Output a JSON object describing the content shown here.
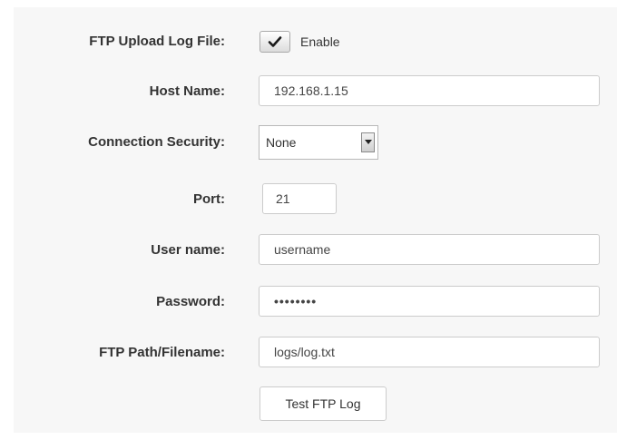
{
  "form": {
    "ftp_upload": {
      "label": "FTP Upload Log File:",
      "checked": true,
      "checkbox_label": "Enable"
    },
    "host_name": {
      "label": "Host Name:",
      "value": "192.168.1.15"
    },
    "connection_security": {
      "label": "Connection Security:",
      "selected": "None"
    },
    "port": {
      "label": "Port:",
      "value": "21"
    },
    "user_name": {
      "label": "User name:",
      "value": "username"
    },
    "password": {
      "label": "Password:",
      "masked_value": "••••••••"
    },
    "ftp_path": {
      "label": "FTP Path/Filename:",
      "value": "logs/log.txt"
    },
    "test_button": {
      "label": "Test FTP Log"
    }
  },
  "icons": {
    "checkbox_mark": "checkmark-icon",
    "select_arrow": "chevron-down-icon"
  }
}
